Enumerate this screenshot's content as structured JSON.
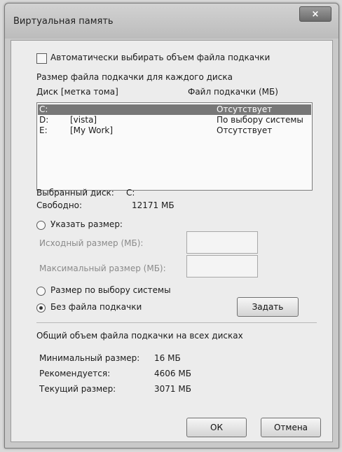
{
  "window": {
    "title": "Виртуальная память",
    "close_glyph": "×"
  },
  "auto_checkbox": {
    "label": "Автоматически выбирать объем файла подкачки",
    "checked": false
  },
  "drives_section": {
    "heading": "Размер файла подкачки для каждого диска",
    "col_disk": "Диск [метка тома]",
    "col_file": "Файл подкачки (МБ)",
    "rows": [
      {
        "drive": "C:",
        "label": "",
        "value": "Отсутствует",
        "selected": true
      },
      {
        "drive": "D:",
        "label": "[vista]",
        "value": "По выбору системы",
        "selected": false
      },
      {
        "drive": "E:",
        "label": "[My Work]",
        "value": "Отсутствует",
        "selected": false
      }
    ]
  },
  "selected_disk": {
    "disk_label": "Выбранный диск:",
    "disk_value": "C:",
    "free_label": "Свободно:",
    "free_value": "12171 МБ"
  },
  "size_options": {
    "custom_label": "Указать размер:",
    "initial_label": "Исходный размер (МБ):",
    "initial_value": "",
    "max_label": "Максимальный размер (МБ):",
    "max_value": "",
    "system_label": "Размер по выбору системы",
    "none_label": "Без файла подкачки",
    "selected": "none",
    "set_button": "Задать"
  },
  "totals": {
    "heading": "Общий объем файла подкачки на всех дисках",
    "min_label": "Минимальный размер:",
    "min_value": "16 МБ",
    "rec_label": "Рекомендуется:",
    "rec_value": "4606 МБ",
    "cur_label": "Текущий размер:",
    "cur_value": "3071 МБ"
  },
  "buttons": {
    "ok": "ОК",
    "cancel": "Отмена"
  }
}
